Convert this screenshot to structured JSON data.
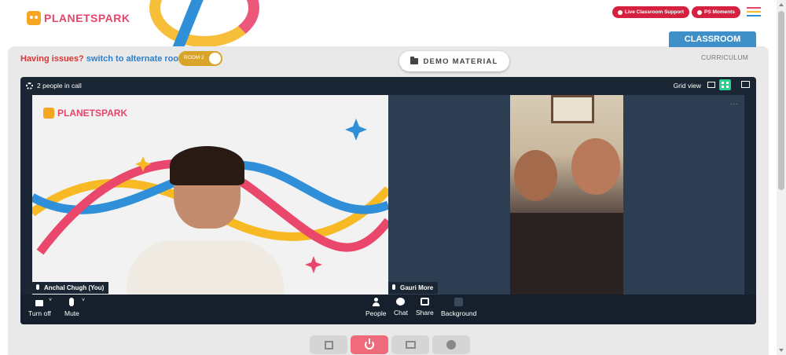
{
  "header": {
    "logo_text": "PLANETSPARK",
    "live_support_label": "Live Classroom Support",
    "ps_moments_label": "PS Moments",
    "classroom_tab": "CLASSROOM",
    "curriculum_link": "CURRICULUM"
  },
  "issues": {
    "prefix": "Having issues?",
    "link": "switch to alternate room",
    "room_label": "ROOM 2"
  },
  "demo_material_label": "DEMO MATERIAL",
  "call": {
    "people_count": "2 people in call",
    "grid_view_label": "Grid view",
    "tiles": [
      {
        "name": "Anchal Chugh (You)"
      },
      {
        "name": "Gauri More"
      }
    ],
    "controls_left": [
      {
        "label": "Turn off",
        "icon": "video-icon"
      },
      {
        "label": "Mute",
        "icon": "mic-icon"
      }
    ],
    "controls_center": [
      {
        "label": "People",
        "icon": "people-icon"
      },
      {
        "label": "Chat",
        "icon": "chat-icon"
      },
      {
        "label": "Share",
        "icon": "share-icon"
      },
      {
        "label": "Background",
        "icon": "background-icon"
      }
    ]
  },
  "bottom_bar": [
    "expand-icon",
    "power-icon",
    "screen-icon",
    "palette-icon"
  ],
  "colors": {
    "brand_red": "#d5203f",
    "classroom_blue": "#3f8fc9",
    "call_bg": "#1a2633",
    "grid_active": "#2ad28f",
    "end_call": "#ef6a7a"
  }
}
